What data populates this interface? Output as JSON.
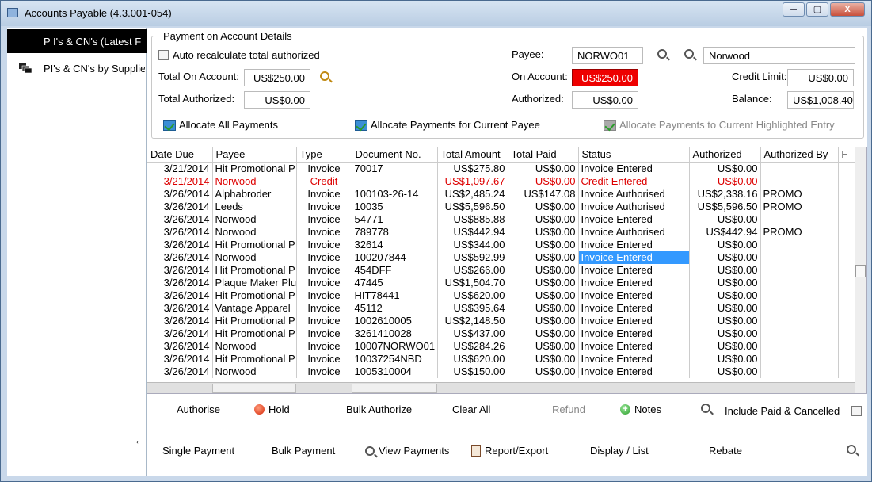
{
  "window": {
    "title": "Accounts Payable (4.3.001-054)",
    "buttons": [
      "─",
      "▢",
      "X"
    ]
  },
  "nav": {
    "items": [
      {
        "label": "P I's & CN's (Latest F",
        "icon": "pi-cn-list-icon"
      },
      {
        "label": "PI's & CN's by Supplie",
        "icon": "supplier-stack-icon"
      }
    ],
    "back": "←"
  },
  "details": {
    "group_title": "Payment on Account Details",
    "auto_recalc_label": "Auto recalculate total authorized",
    "total_on_account_label": "Total On Account:",
    "total_on_account_value": "US$250.00",
    "total_authorized_label": "Total Authorized:",
    "total_authorized_value": "US$0.00",
    "payee_label": "Payee:",
    "payee_code": "NORWO01",
    "payee_name": "Norwood",
    "on_account_label": "On Account:",
    "on_account_value": "US$250.00",
    "authorized_label": "Authorized:",
    "authorized_value": "US$0.00",
    "credit_limit_label": "Credit Limit:",
    "credit_limit_value": "US$0.00",
    "balance_label": "Balance:",
    "balance_value": "US$1,008.40",
    "allocate_all": "Allocate All Payments",
    "allocate_current_payee": "Allocate Payments for Current Payee",
    "allocate_highlighted": "Allocate Payments to Current Highlighted Entry"
  },
  "grid": {
    "columns": [
      "Date Due",
      "Payee",
      "Type",
      "Document No.",
      "Total Amount",
      "Total Paid",
      "Status",
      "Authorized",
      "Authorized By",
      "F"
    ],
    "rows": [
      [
        "3/21/2014",
        "Hit Promotional P",
        "Invoice",
        "70017",
        "US$275.80",
        "US$0.00",
        "Invoice Entered",
        "US$0.00",
        ""
      ],
      [
        "3/21/2014",
        "Norwood",
        "Credit",
        "",
        "US$1,097.67",
        "US$0.00",
        "Credit Entered",
        "US$0.00",
        ""
      ],
      [
        "3/26/2014",
        "Alphabroder",
        "Invoice",
        "100103-26-14",
        "US$2,485.24",
        "US$147.08",
        "Invoice Authorised",
        "US$2,338.16",
        "PROMO"
      ],
      [
        "3/26/2014",
        "Leeds",
        "Invoice",
        "10035",
        "US$5,596.50",
        "US$0.00",
        "Invoice Authorised",
        "US$5,596.50",
        "PROMO"
      ],
      [
        "3/26/2014",
        "Norwood",
        "Invoice",
        "54771",
        "US$885.88",
        "US$0.00",
        "Invoice Entered",
        "US$0.00",
        ""
      ],
      [
        "3/26/2014",
        "Norwood",
        "Invoice",
        "789778",
        "US$442.94",
        "US$0.00",
        "Invoice Authorised",
        "US$442.94",
        "PROMO"
      ],
      [
        "3/26/2014",
        "Hit Promotional P",
        "Invoice",
        "32614",
        "US$344.00",
        "US$0.00",
        "Invoice Entered",
        "US$0.00",
        ""
      ],
      [
        "3/26/2014",
        "Norwood",
        "Invoice",
        "100207844",
        "US$592.99",
        "US$0.00",
        "Invoice Entered",
        "US$0.00",
        ""
      ],
      [
        "3/26/2014",
        "Hit Promotional P",
        "Invoice",
        "454DFF",
        "US$266.00",
        "US$0.00",
        "Invoice Entered",
        "US$0.00",
        ""
      ],
      [
        "3/26/2014",
        "Plaque Maker Plu",
        "Invoice",
        "47445",
        "US$1,504.70",
        "US$0.00",
        "Invoice Entered",
        "US$0.00",
        ""
      ],
      [
        "3/26/2014",
        "Hit Promotional P",
        "Invoice",
        "HIT78441",
        "US$620.00",
        "US$0.00",
        "Invoice Entered",
        "US$0.00",
        ""
      ],
      [
        "3/26/2014",
        "Vantage Apparel",
        "Invoice",
        "45112",
        "US$395.64",
        "US$0.00",
        "Invoice Entered",
        "US$0.00",
        ""
      ],
      [
        "3/26/2014",
        "Hit Promotional P",
        "Invoice",
        "1002610005",
        "US$2,148.50",
        "US$0.00",
        "Invoice Entered",
        "US$0.00",
        ""
      ],
      [
        "3/26/2014",
        "Hit Promotional P",
        "Invoice",
        "3261410028",
        "US$437.00",
        "US$0.00",
        "Invoice Entered",
        "US$0.00",
        ""
      ],
      [
        "3/26/2014",
        "Norwood",
        "Invoice",
        "10007NORWO01",
        "US$284.26",
        "US$0.00",
        "Invoice Entered",
        "US$0.00",
        ""
      ],
      [
        "3/26/2014",
        "Hit Promotional P",
        "Invoice",
        "10037254NBD",
        "US$620.00",
        "US$0.00",
        "Invoice Entered",
        "US$0.00",
        ""
      ],
      [
        "3/26/2014",
        "Norwood",
        "Invoice",
        "1005310004",
        "US$150.00",
        "US$0.00",
        "Invoice Entered",
        "US$0.00",
        ""
      ]
    ],
    "red_row_index": 1,
    "highlight_row_index": 7,
    "highlight_col_index": 6
  },
  "actions": {
    "authorise": "Authorise",
    "hold": "Hold",
    "bulk_authorize": "Bulk Authorize",
    "clear_all": "Clear All",
    "refund": "Refund",
    "notes": "Notes",
    "include_paid": "Include Paid & Cancelled"
  },
  "bottom": {
    "single_payment": "Single Payment",
    "bulk_payment": "Bulk Payment",
    "view_payments": "View Payments",
    "report_export": "Report/Export",
    "display_list": "Display / List",
    "rebate": "Rebate"
  },
  "colors": {
    "credit_red": "#dd0000",
    "highlight": "#3399ff",
    "on_account_bg": "#ee0000"
  }
}
